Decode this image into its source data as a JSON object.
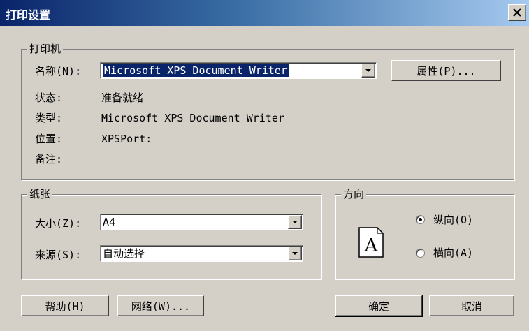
{
  "window": {
    "title": "打印设置",
    "close_label": "×"
  },
  "printer_group": {
    "legend": "打印机",
    "name_label": "名称(N):",
    "name_value": "Microsoft XPS Document Writer",
    "properties_button": "属性(P)...",
    "status_label": "状态:",
    "status_value": "准备就绪",
    "type_label": "类型:",
    "type_value": "Microsoft XPS Document Writer",
    "location_label": "位置:",
    "location_value": "XPSPort:",
    "comment_label": "备注:",
    "comment_value": ""
  },
  "paper_group": {
    "legend": "纸张",
    "size_label": "大小(Z):",
    "size_value": "A4",
    "source_label": "来源(S):",
    "source_value": "自动选择"
  },
  "orientation_group": {
    "legend": "方向",
    "icon_letter": "A",
    "portrait_label": "纵向(O)",
    "landscape_label": "横向(A)",
    "selected": "portrait"
  },
  "buttons": {
    "help": "帮助(H)",
    "network": "网络(W)...",
    "ok": "确定",
    "cancel": "取消"
  }
}
